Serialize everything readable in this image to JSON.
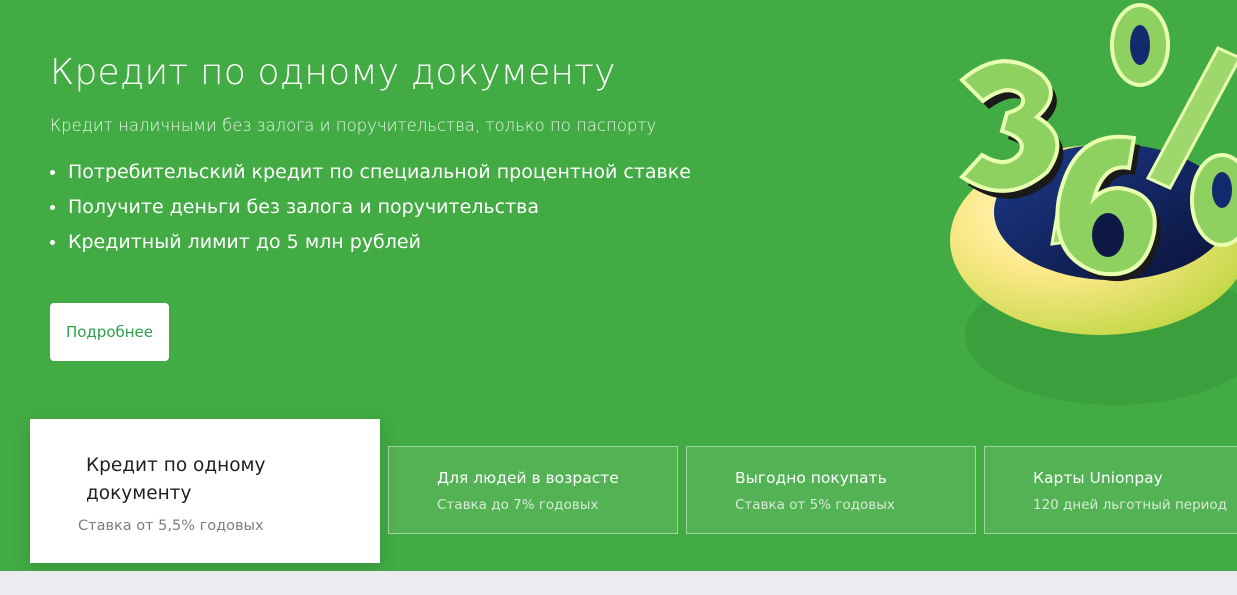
{
  "hero": {
    "title": "Кредит по одному документу",
    "subtitle": "Кредит наличными без залога и поручительства, только по паспорту",
    "bullets": [
      "Потребительский кредит по специальной процентной ставке",
      "Получите деньги без залога и поручительства",
      "Кредитный лимит до 5 млн рублей"
    ],
    "button_label": "Подробнее"
  },
  "cards": [
    {
      "title": "Кредит по одному документу",
      "subtitle": "Ставка от 5,5% годовых",
      "active": true
    },
    {
      "title": "Для людей в возрасте",
      "subtitle": "Ставка до 7% годовых"
    },
    {
      "title": "Выгодно покупать",
      "subtitle": "Ставка от 5% годовых"
    },
    {
      "title": "Карты Unionpay",
      "subtitle": "120 дней льготный период"
    }
  ],
  "colors": {
    "brand_green": "#42ab44",
    "button_text": "#2aa04a",
    "footer_bg": "#ebecf0"
  },
  "icons": [
    "percent-illustration"
  ]
}
